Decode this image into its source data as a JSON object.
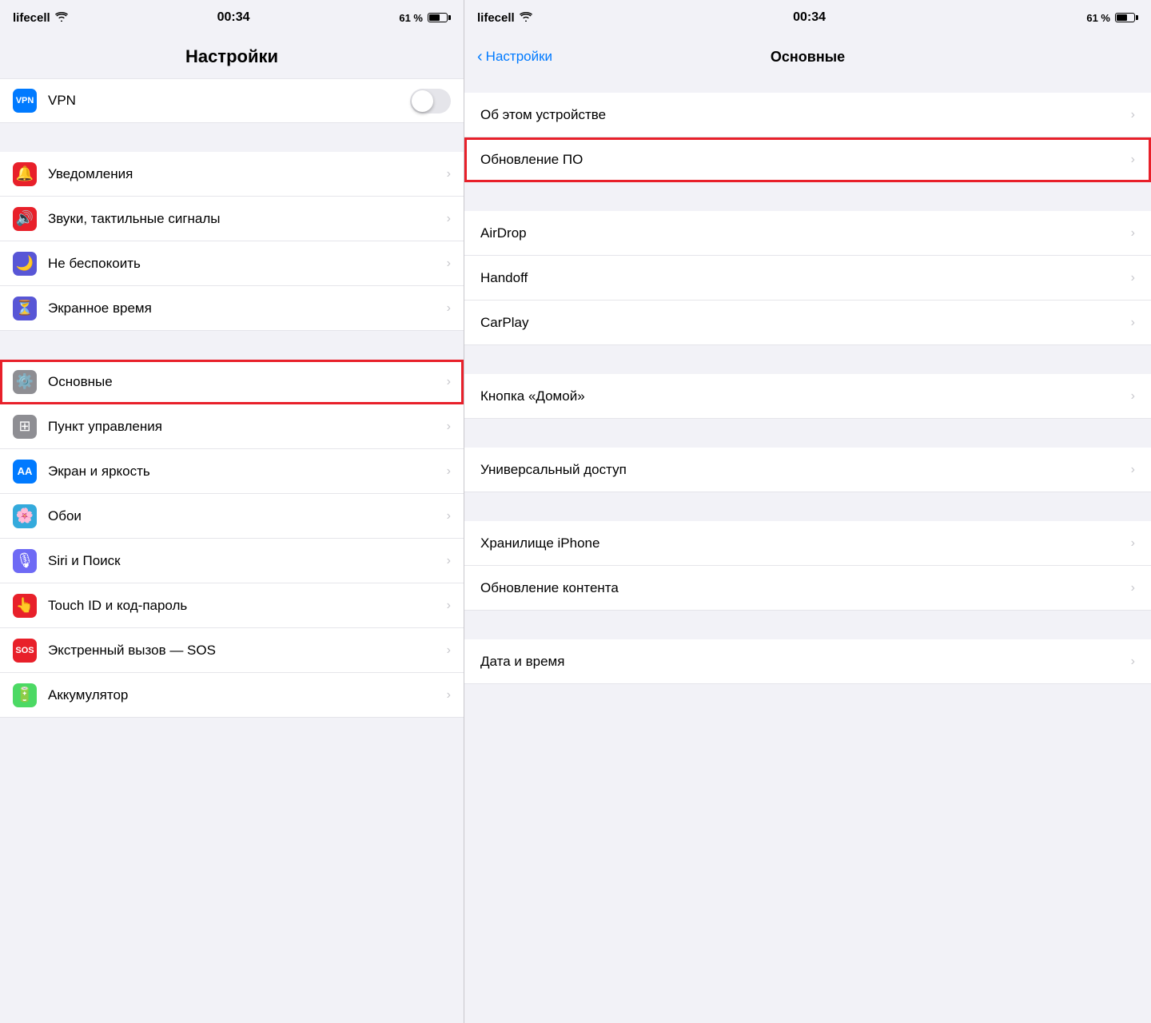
{
  "left": {
    "status": {
      "carrier": "lifecell",
      "time": "00:34",
      "battery": "61 %"
    },
    "title": "Настройки",
    "rows": [
      {
        "id": "vpn",
        "icon": "vpn",
        "label": "VPN",
        "type": "toggle",
        "highlighted": false
      },
      {
        "id": "notifications",
        "icon": "notif",
        "label": "Уведомления",
        "type": "chevron",
        "highlighted": false
      },
      {
        "id": "sounds",
        "icon": "sound",
        "label": "Звуки, тактильные сигналы",
        "type": "chevron",
        "highlighted": false
      },
      {
        "id": "dnd",
        "icon": "dnd",
        "label": "Не беспокоить",
        "type": "chevron",
        "highlighted": false
      },
      {
        "id": "screentime",
        "icon": "screentime",
        "label": "Экранное время",
        "type": "chevron",
        "highlighted": false
      },
      {
        "id": "general",
        "icon": "general",
        "label": "Основные",
        "type": "chevron",
        "highlighted": true
      },
      {
        "id": "control",
        "icon": "control",
        "label": "Пункт управления",
        "type": "chevron",
        "highlighted": false
      },
      {
        "id": "display",
        "icon": "display",
        "label": "Экран и яркость",
        "type": "chevron",
        "highlighted": false
      },
      {
        "id": "wallpaper",
        "icon": "wallpaper",
        "label": "Обои",
        "type": "chevron",
        "highlighted": false
      },
      {
        "id": "siri",
        "icon": "siri",
        "label": "Siri и Поиск",
        "type": "chevron",
        "highlighted": false
      },
      {
        "id": "touchid",
        "icon": "touchid",
        "label": "Touch ID и код-пароль",
        "type": "chevron",
        "highlighted": false
      },
      {
        "id": "sos",
        "icon": "sos",
        "label": "Экстренный вызов — SOS",
        "type": "chevron",
        "highlighted": false
      },
      {
        "id": "battery",
        "icon": "battery",
        "label": "Аккумулятор",
        "type": "chevron",
        "highlighted": false
      }
    ]
  },
  "right": {
    "status": {
      "carrier": "lifecell",
      "time": "00:34",
      "battery": "61 %"
    },
    "back_label": "Настройки",
    "title": "Основные",
    "sections": [
      {
        "rows": [
          {
            "id": "about",
            "label": "Об этом устройстве",
            "highlighted": false
          },
          {
            "id": "update",
            "label": "Обновление ПО",
            "highlighted": true
          }
        ]
      },
      {
        "rows": [
          {
            "id": "airdrop",
            "label": "AirDrop",
            "highlighted": false
          },
          {
            "id": "handoff",
            "label": "Handoff",
            "highlighted": false
          },
          {
            "id": "carplay",
            "label": "CarPlay",
            "highlighted": false
          }
        ]
      },
      {
        "rows": [
          {
            "id": "homebutton",
            "label": "Кнопка «Домой»",
            "highlighted": false
          }
        ]
      },
      {
        "rows": [
          {
            "id": "accessibility",
            "label": "Универсальный доступ",
            "highlighted": false
          }
        ]
      },
      {
        "rows": [
          {
            "id": "storage",
            "label": "Хранилище iPhone",
            "highlighted": false
          },
          {
            "id": "bgrefresh",
            "label": "Обновление контента",
            "highlighted": false
          }
        ]
      },
      {
        "rows": [
          {
            "id": "datetime",
            "label": "Дата и время",
            "highlighted": false
          }
        ]
      }
    ]
  }
}
